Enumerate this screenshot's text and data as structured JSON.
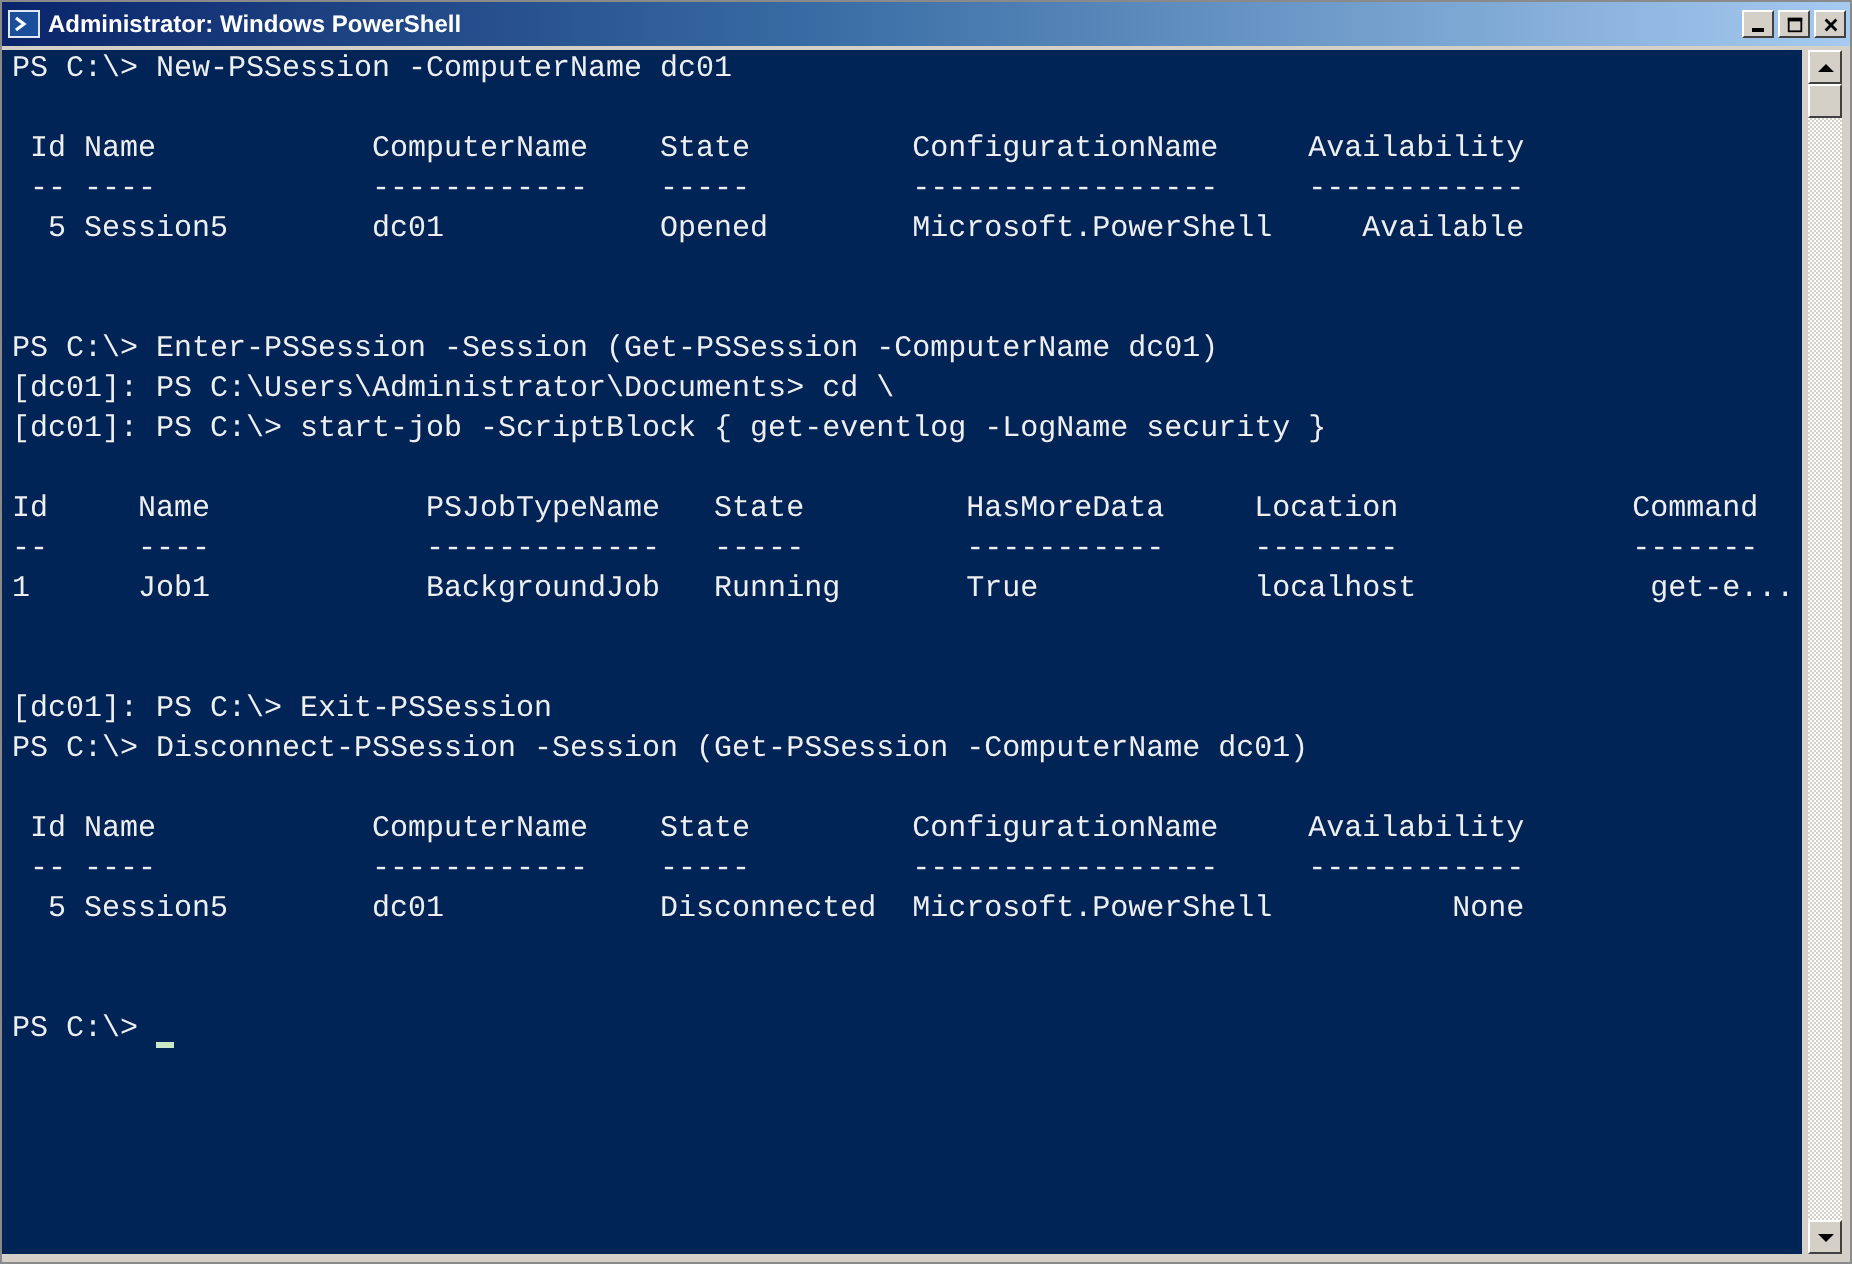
{
  "window": {
    "title": "Administrator: Windows PowerShell",
    "buttons": [
      {
        "kind": "minimize"
      },
      {
        "kind": "maximize"
      },
      {
        "kind": "close"
      }
    ]
  },
  "console": {
    "lines": [
      {
        "kind": "text",
        "text": "PS C:\\> New-PSSession -ComputerName dc01"
      },
      {
        "kind": "blank"
      },
      {
        "kind": "text",
        "text": " Id Name            ComputerName    State         ConfigurationName     Availability"
      },
      {
        "kind": "text",
        "text": " -- ----            ------------    -----         -----------------     ------------"
      },
      {
        "kind": "text",
        "text": "  5 Session5        dc01            Opened        Microsoft.PowerShell     Available"
      },
      {
        "kind": "blank"
      },
      {
        "kind": "blank"
      },
      {
        "kind": "text",
        "text": "PS C:\\> Enter-PSSession -Session (Get-PSSession -ComputerName dc01)"
      },
      {
        "kind": "text",
        "text": "[dc01]: PS C:\\Users\\Administrator\\Documents> cd \\"
      },
      {
        "kind": "text",
        "text": "[dc01]: PS C:\\> start-job -ScriptBlock { get-eventlog -LogName security }"
      },
      {
        "kind": "blank"
      },
      {
        "kind": "text",
        "text": "Id     Name            PSJobTypeName   State         HasMoreData     Location             Command"
      },
      {
        "kind": "text",
        "text": "--     ----            -------------   -----         -----------     --------             -------"
      },
      {
        "kind": "text",
        "text": "1      Job1            BackgroundJob   Running       True            localhost             get-e..."
      },
      {
        "kind": "blank"
      },
      {
        "kind": "blank"
      },
      {
        "kind": "text",
        "text": "[dc01]: PS C:\\> Exit-PSSession"
      },
      {
        "kind": "text",
        "text": "PS C:\\> Disconnect-PSSession -Session (Get-PSSession -ComputerName dc01)"
      },
      {
        "kind": "blank"
      },
      {
        "kind": "text",
        "text": " Id Name            ComputerName    State         ConfigurationName     Availability"
      },
      {
        "kind": "text",
        "text": " -- ----            ------------    -----         -----------------     ------------"
      },
      {
        "kind": "text",
        "text": "  5 Session5        dc01            Disconnected  Microsoft.PowerShell          None"
      },
      {
        "kind": "blank"
      },
      {
        "kind": "blank"
      },
      {
        "kind": "prompt",
        "text": "PS C:\\>"
      }
    ]
  }
}
